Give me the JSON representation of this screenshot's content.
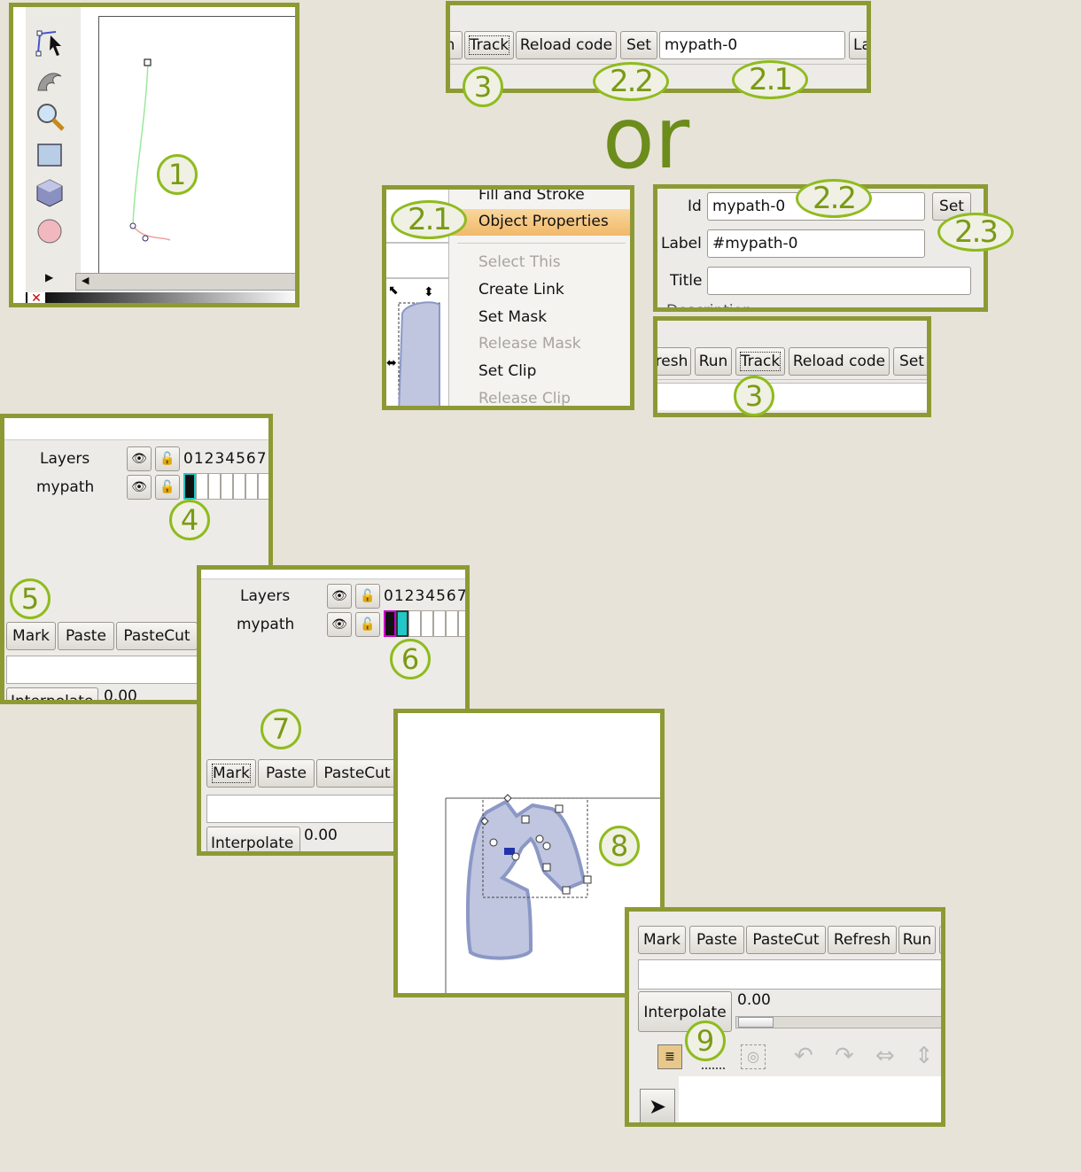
{
  "or_text": "or",
  "callouts": {
    "c1": "1",
    "c3a": "3",
    "c22a": "2.2",
    "c21a": "2.1",
    "c21b": "2.1",
    "c22b": "2.2",
    "c23": "2.3",
    "c3b": "3",
    "c4": "4",
    "c5": "5",
    "c6": "6",
    "c7": "7",
    "c8": "8",
    "c9": "9"
  },
  "toolbar_top": {
    "track": "Track",
    "reload": "Reload code",
    "set": "Set",
    "id_value": "mypath-0",
    "next_label": "La"
  },
  "context_menu": {
    "items": [
      "Fill and Stroke",
      "Object Properties",
      "Select This",
      "Create Link",
      "Set Mask",
      "Release Mask",
      "Set Clip",
      "Release Clip"
    ],
    "highlight_index": 1
  },
  "object_props": {
    "id_label": "Id",
    "id_value": "mypath-0",
    "set": "Set",
    "label_label": "Label",
    "label_value": "#mypath-0",
    "title_label": "Title",
    "title_value": "",
    "description_label": "Description"
  },
  "toolbar_mid": {
    "refresh": "resh",
    "run": "Run",
    "track": "Track",
    "reload": "Reload code",
    "set": "Set"
  },
  "layers_a": {
    "header": "Layers",
    "frames_header": "01234567",
    "layer_name": "mypath",
    "buttons": [
      "Mark",
      "Paste",
      "PasteCut"
    ],
    "slider_value": "0.00",
    "interpolate": "Interpolate"
  },
  "layers_b": {
    "header": "Layers",
    "frames_header": "01234567",
    "layer_name": "mypath",
    "buttons": [
      "Mark",
      "Paste",
      "PasteCut"
    ],
    "slider_value": "0.00",
    "interpolate": "Interpolate"
  },
  "toolbar_bottom": {
    "buttons": [
      "Mark",
      "Paste",
      "PasteCut",
      "Refresh",
      "Run"
    ],
    "interpolate": "Interpolate",
    "slider_value": "0.00"
  },
  "colors": {
    "frame_border": "#8d9a34",
    "callout_border": "#8fbb1f",
    "callout_text": "#7a9a16",
    "shape_fill": "#c0c6df",
    "shape_stroke": "#8b98c6",
    "menu_highlight": "#f5c77e",
    "keyframe_magenta": "#cc00cc",
    "keyframe_cyan": "#22c7c7"
  }
}
